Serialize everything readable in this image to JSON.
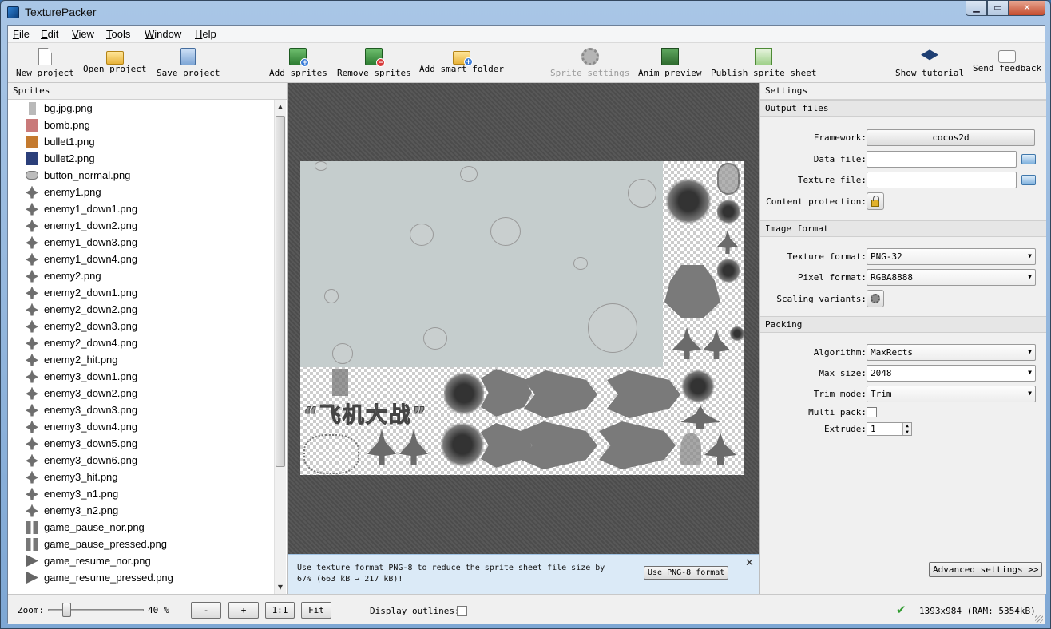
{
  "window": {
    "title": "TexturePacker"
  },
  "menu": [
    "File",
    "Edit",
    "View",
    "Tools",
    "Window",
    "Help"
  ],
  "toolbar": {
    "new_project": "New project",
    "open_project": "Open project",
    "save_project": "Save project",
    "add_sprites": "Add sprites",
    "remove_sprites": "Remove sprites",
    "add_smart_folder": "Add smart folder",
    "sprite_settings": "Sprite settings",
    "anim_preview": "Anim preview",
    "publish_sprite_sheet": "Publish sprite sheet",
    "show_tutorial": "Show tutorial",
    "send_feedback": "Send feedback"
  },
  "sprites_panel": {
    "title": "Sprites",
    "items": [
      "bg.jpg.png",
      "bomb.png",
      "bullet1.png",
      "bullet2.png",
      "button_normal.png",
      "enemy1.png",
      "enemy1_down1.png",
      "enemy1_down2.png",
      "enemy1_down3.png",
      "enemy1_down4.png",
      "enemy2.png",
      "enemy2_down1.png",
      "enemy2_down2.png",
      "enemy2_down3.png",
      "enemy2_down4.png",
      "enemy2_hit.png",
      "enemy3_down1.png",
      "enemy3_down2.png",
      "enemy3_down3.png",
      "enemy3_down4.png",
      "enemy3_down5.png",
      "enemy3_down6.png",
      "enemy3_hit.png",
      "enemy3_n1.png",
      "enemy3_n2.png",
      "game_pause_nor.png",
      "game_pause_pressed.png",
      "game_resume_nor.png",
      "game_resume_pressed.png"
    ]
  },
  "canvas": {
    "logo_text": "“飞机大战”"
  },
  "hint": {
    "text": "Use texture format PNG-8 to reduce the sprite sheet file size by 67% (663 kB → 217 kB)!",
    "button": "Use PNG-8 format",
    "close": "✕"
  },
  "settings": {
    "title": "Settings",
    "output_files": {
      "title": "Output files",
      "framework_label": "Framework:",
      "framework_value": "cocos2d",
      "data_file_label": "Data file:",
      "data_file_value": "",
      "texture_file_label": "Texture file:",
      "texture_file_value": "",
      "content_protection_label": "Content protection:"
    },
    "image_format": {
      "title": "Image format",
      "texture_format_label": "Texture format:",
      "texture_format_value": "PNG-32",
      "pixel_format_label": "Pixel format:",
      "pixel_format_value": "RGBA8888",
      "scaling_variants_label": "Scaling variants:"
    },
    "packing": {
      "title": "Packing",
      "algorithm_label": "Algorithm:",
      "algorithm_value": "MaxRects",
      "max_size_label": "Max size:",
      "max_size_value": "2048",
      "trim_mode_label": "Trim mode:",
      "trim_mode_value": "Trim",
      "multi_pack_label": "Multi pack:",
      "multi_pack_checked": false,
      "extrude_label": "Extrude:",
      "extrude_value": "1"
    },
    "advanced_button": "Advanced settings >>"
  },
  "statusbar": {
    "zoom_label": "Zoom:",
    "zoom_value": "40 %",
    "zoom_slider_percent": 40,
    "minus": "-",
    "plus": "+",
    "one_to_one": "1:1",
    "fit": "Fit",
    "display_outlines_label": "Display outlines:",
    "display_outlines_checked": false,
    "status_text": "1393x984 (RAM: 5354kB)"
  },
  "colors": {
    "hint_bg": "#dbeaf7",
    "canvas_bg": "#525252",
    "ok_green": "#2e9b2e"
  }
}
